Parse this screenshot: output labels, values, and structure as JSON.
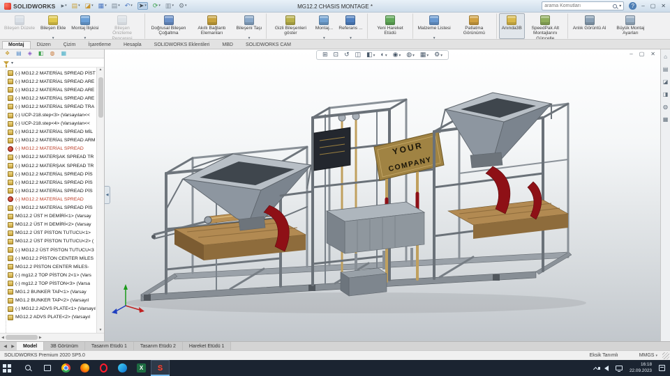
{
  "titlebar": {
    "brand": "SOLIDWORKS",
    "doc_title": "MG12.2 CHASIS MONTAGE *",
    "search": {
      "placeholder": "arama Komutları"
    },
    "quick_icons": [
      {
        "name": "brand-menu-arrow-icon",
        "glyph": "▸",
        "color": "#5a6570"
      },
      {
        "name": "new-file-icon",
        "glyph": "▤",
        "color": "#caa23c",
        "arrow": true
      },
      {
        "name": "open-file-icon",
        "glyph": "◪",
        "color": "#c8952e",
        "arrow": true
      },
      {
        "name": "save-icon",
        "glyph": "▦",
        "color": "#4a76c0",
        "arrow": true
      },
      {
        "name": "print-icon",
        "glyph": "▤",
        "color": "#7d8a96",
        "arrow": true
      },
      {
        "name": "undo-icon",
        "glyph": "↶",
        "color": "#4a76c0",
        "arrow": true
      },
      {
        "name": "select-icon",
        "glyph": "➤",
        "color": "#3c444c",
        "active": true,
        "arrow": true
      },
      {
        "name": "rebuild-icon",
        "glyph": "⟳",
        "color": "#3aa04a",
        "arrow": true
      },
      {
        "name": "file-properties-icon",
        "glyph": "▥",
        "color": "#7d8a96"
      },
      {
        "name": "options-icon",
        "glyph": "⚙",
        "color": "#707a84",
        "arrow": true
      }
    ],
    "window_controls": [
      {
        "name": "minimize-button",
        "glyph": "–"
      },
      {
        "name": "maximize-button",
        "glyph": "▢"
      },
      {
        "name": "close-button",
        "glyph": "✕"
      }
    ],
    "help_glyph": "?"
  },
  "ribbon": {
    "buttons": [
      {
        "name": "edit-component-button",
        "label": "Bileşen Düzele",
        "color": "#b8c8d8",
        "disabled": true
      },
      {
        "name": "insert-component-button",
        "label": "Bileşen Ekle",
        "color": "#e0c84a",
        "arrow": true
      },
      {
        "name": "mate-button",
        "label": "Montaj İlişkisi",
        "color": "#6aa0d8",
        "arrow": true
      },
      {
        "name": "component-preview-window-button",
        "label": "Bileşen Önizleme Penceresi",
        "color": "#c0ccd8",
        "disabled": true,
        "sep_after": true
      },
      {
        "name": "linear-component-pattern-button",
        "label": "Doğrusal Bileşen Çoğaltma",
        "color": "#6a90c8",
        "arrow": true
      },
      {
        "name": "smart-fasteners-button",
        "label": "Akıllı Bağlantı Elemanları",
        "color": "#c8a23c",
        "arrow": true
      },
      {
        "name": "move-component-button",
        "label": "Bileşeni Taşı",
        "color": "#8aa8c8",
        "arrow": true,
        "sep_after": true
      },
      {
        "name": "show-hidden-components-button",
        "label": "Gizli Bileşenleri göster",
        "color": "#b8b04a"
      },
      {
        "name": "assembly-features-button",
        "label": "Montaj...",
        "color": "#70a0d0",
        "arrow": true
      },
      {
        "name": "reference-geometry-button",
        "label": "Referans ...",
        "color": "#5080c0",
        "arrow": true,
        "sep_after": true
      },
      {
        "name": "new-motion-study-button",
        "label": "Yeni Hareket Etüdü",
        "color": "#60a858",
        "sep_after": true
      },
      {
        "name": "bill-of-materials-button",
        "label": "Malzeme Listesi",
        "color": "#6898d0",
        "arrow": true
      },
      {
        "name": "exploded-view-button",
        "label": "Patlatma Görünümü",
        "color": "#d0a040",
        "arrow": true,
        "sep_after": true
      },
      {
        "name": "instant3d-button",
        "label": "Anında3B",
        "color": "#d8b84a",
        "active": true
      },
      {
        "name": "update-speedpak-button",
        "label": "SpeedPak Alt Montajlarını Güncelle",
        "color": "#8fae5a",
        "sep_after": true
      },
      {
        "name": "take-snapshot-button",
        "label": "Anlık Görüntü Al",
        "color": "#8aa0b4"
      },
      {
        "name": "large-assembly-settings-button",
        "label": "Büyük Montaj Ayarları",
        "color": "#9bb0c4",
        "arrow": true
      }
    ]
  },
  "command_tabs": [
    {
      "name": "tab-montaj",
      "label": "Montaj",
      "active": true
    },
    {
      "name": "tab-duzen",
      "label": "Düzen"
    },
    {
      "name": "tab-cizim",
      "label": "Çizim"
    },
    {
      "name": "tab-isaretleme",
      "label": "İşaretleme"
    },
    {
      "name": "tab-hesapla",
      "label": "Hesapla"
    },
    {
      "name": "tab-solidworks-eklentileri",
      "label": "SOLIDWORKS Eklentileri"
    },
    {
      "name": "tab-mbd",
      "label": "MBD"
    },
    {
      "name": "tab-solidworks-cam",
      "label": "SOLIDWORKS CAM"
    }
  ],
  "tree_panel": {
    "tabs": [
      {
        "name": "featuremanager-tab-icon",
        "glyph": "❖",
        "color": "#caa23c"
      },
      {
        "name": "propertymanager-tab-icon",
        "glyph": "▤",
        "color": "#4a86c8"
      },
      {
        "name": "configurationmanager-tab-icon",
        "glyph": "◈",
        "color": "#8a5ac8"
      },
      {
        "name": "dimxpertmanager-tab-icon",
        "glyph": "◧",
        "color": "#3aa04a"
      },
      {
        "name": "displaymanager-tab-icon",
        "glyph": "◍",
        "color": "#c87a3a"
      },
      {
        "name": "cam-tree-tab-icon",
        "glyph": "▦",
        "color": "#4ab0c8"
      }
    ],
    "items": [
      {
        "label": "(-) MG12.2 MATERİAL SPREAD PİST"
      },
      {
        "label": "(-) MG12.2 MATERİAL SPREAD ARE"
      },
      {
        "label": "(-) MG12.2 MATERİAL SPREAD ARE"
      },
      {
        "label": "(-) MG12.2 MATERİAL SPREAD ARE"
      },
      {
        "label": "(-) MG12.2 MATERİAL SPREAD TRA"
      },
      {
        "label": "(-) UCP-218.step<3> (Varsayılan<<"
      },
      {
        "label": "(-) UCP-218.step<4> (Varsayılan<<"
      },
      {
        "label": "(-) MG12.2 MATERİAL SPREAD MİL"
      },
      {
        "label": "(-) MG12.2 MATERİAL SPREAD ARM"
      },
      {
        "label": "(-) MG12.2 MATERİAL SPREAD",
        "error": true
      },
      {
        "label": "(-) MG12.2 MATERŞAK SPREAD TR"
      },
      {
        "label": "(-) MG12.2 MATERŞAK SPREAD TR"
      },
      {
        "label": "(-) MG12.2 MATERİAL SPREAD PİS"
      },
      {
        "label": "(-) MG12.2 MATERİAL SPREAD PİS"
      },
      {
        "label": "(-) MG12.2 MATERİAL SPREAD PİS"
      },
      {
        "label": "(-) MG12.2 MATERİAL SPREAD",
        "error": true
      },
      {
        "label": "(-) MG12.2 MATERİAL SPREAD PİS"
      },
      {
        "label": "MG12.2 ÜST H DEMİRİ<1> (Varsay"
      },
      {
        "label": "MG12.2 ÜST H DEMİRİ<2> (Varsay"
      },
      {
        "label": "MG12.2 ÜST PİSTON TUTUCU<1>"
      },
      {
        "label": "MG12.2 ÜST PİSTON TUTUCU<2> ("
      },
      {
        "label": "(-) MG12.2 ÜST PİSTON TUTUCU<3"
      },
      {
        "label": "(-) MG12.2 PİSTON CENTER MİLES"
      },
      {
        "label": "MG12.2 PİSTON CENTER MİLES-"
      },
      {
        "label": "(-) mg12.2 TOP PİSTON 2<1> (Vars"
      },
      {
        "label": "(-) mg12.2 TOP PİSTON<3> (Varsa"
      },
      {
        "label": "MG1.2 BUNKER TAP<1> (Varsay"
      },
      {
        "label": "MG1.2 BUNKER TAP<2> (Varsayıl"
      },
      {
        "label": "(-) MG12.2 ADVS PLATE<1> (Varsayıl"
      },
      {
        "label": "MG12.2 ADVS PLATE<2> (Varsayıl"
      }
    ]
  },
  "headsup": {
    "icons": [
      {
        "name": "zoom-fit-icon",
        "glyph": "⊞"
      },
      {
        "name": "zoom-area-icon",
        "glyph": "⊡"
      },
      {
        "name": "previous-view-icon",
        "glyph": "↺"
      },
      {
        "name": "section-view-icon",
        "glyph": "◫"
      },
      {
        "name": "view-orientation-icon",
        "glyph": "◧",
        "arrow": true
      },
      {
        "name": "display-style-icon",
        "glyph": "◐",
        "arrow": true
      },
      {
        "name": "hide-show-items-icon",
        "glyph": "◉",
        "arrow": true
      },
      {
        "name": "edit-appearance-icon",
        "glyph": "◍",
        "arrow": true
      },
      {
        "name": "apply-scene-icon",
        "glyph": "▦",
        "arrow": true
      },
      {
        "name": "view-settings-icon",
        "glyph": "⚙",
        "arrow": true
      }
    ]
  },
  "doc_controls": [
    {
      "name": "doc-minimize-button",
      "glyph": "–"
    },
    {
      "name": "doc-restore-button",
      "glyph": "▢"
    },
    {
      "name": "doc-close-button",
      "glyph": "✕"
    }
  ],
  "taskpane": {
    "icons": [
      {
        "name": "home-icon",
        "glyph": "⌂"
      },
      {
        "name": "design-library-icon",
        "glyph": "▤"
      },
      {
        "name": "file-explorer-icon",
        "glyph": "◪"
      },
      {
        "name": "view-palette-icon",
        "glyph": "◨"
      },
      {
        "name": "appearances-icon",
        "glyph": "◍"
      },
      {
        "name": "custom-properties-icon",
        "glyph": "▦"
      }
    ]
  },
  "model": {
    "plate_line1": "YOUR",
    "plate_line2": "COMPANY"
  },
  "doc_tabs": [
    {
      "name": "doc-tab-model",
      "label": "Model",
      "active": true
    },
    {
      "name": "doc-tab-3d-view",
      "label": "3B Görünüm"
    },
    {
      "name": "doc-tab-design-study-1",
      "label": "Tasarım Etüdü 1"
    },
    {
      "name": "doc-tab-design-study-2",
      "label": "Tasarım Etüdü 2"
    },
    {
      "name": "doc-tab-motion-study-1",
      "label": "Hareket Etüdü 1"
    }
  ],
  "statusbar": {
    "app_version": "SOLIDWORKS Premium 2020 SP5.0",
    "doc_status": "Eksik Tanımlı",
    "units": "MMGS"
  },
  "taskbar": {
    "icons": [
      {
        "name": "start-icon"
      },
      {
        "name": "search-icon"
      },
      {
        "name": "task-view-icon"
      },
      {
        "name": "chrome-icon"
      },
      {
        "name": "firefox-icon"
      },
      {
        "name": "opera-icon"
      },
      {
        "name": "edge-icon"
      },
      {
        "name": "excel-icon",
        "glyph": "X"
      },
      {
        "name": "solidworks-icon",
        "glyph": "S",
        "active": true
      }
    ],
    "tray_icons": [
      {
        "name": "tray-expand-icon"
      },
      {
        "name": "volume-icon"
      },
      {
        "name": "network-icon"
      }
    ],
    "time": "16:18",
    "date": "22.09.2023",
    "action_center": {
      "name": "action-center-icon"
    }
  }
}
